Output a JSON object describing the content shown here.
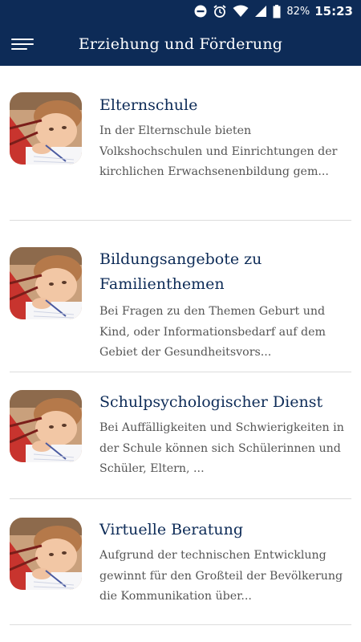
{
  "status_bar": {
    "icons": [
      "do-not-disturb-icon",
      "alarm-icon",
      "wifi-icon",
      "signal-icon",
      "battery-icon"
    ],
    "battery": "82%",
    "time": "15:23"
  },
  "app_bar": {
    "menu_icon": "hamburger-menu-icon",
    "title": "Erziehung und Förderung"
  },
  "colors": {
    "primary": "#0d2b57",
    "title_text": "#0d2b57",
    "body_text": "#555555",
    "divider": "#dcdcdc"
  },
  "items": [
    {
      "title": "Elternschule",
      "description": "In der Elternschule bieten Volkshochschulen und Einrichtungen der kirchlichen Erwachsenenbildung gem...",
      "image": "child-writing-photo"
    },
    {
      "title": "Bildungsangebote zu Familienthemen",
      "description": "Bei Fragen zu den Themen Geburt und Kind, oder Informationsbedarf auf dem Gebiet der Gesundheitsvors...",
      "image": "child-writing-photo"
    },
    {
      "title": "Schulpsychologischer Dienst",
      "description": "Bei Auffälligkeiten und Schwierigkeiten in der Schule können sich Schülerinnen und Schüler, Eltern, ...",
      "image": "child-writing-photo"
    },
    {
      "title": "Virtuelle Beratung",
      "description": "Aufgrund der technischen Entwicklung gewinnt für den Großteil der Bevölkerung die Kommunikation über...",
      "image": "child-writing-photo"
    }
  ]
}
